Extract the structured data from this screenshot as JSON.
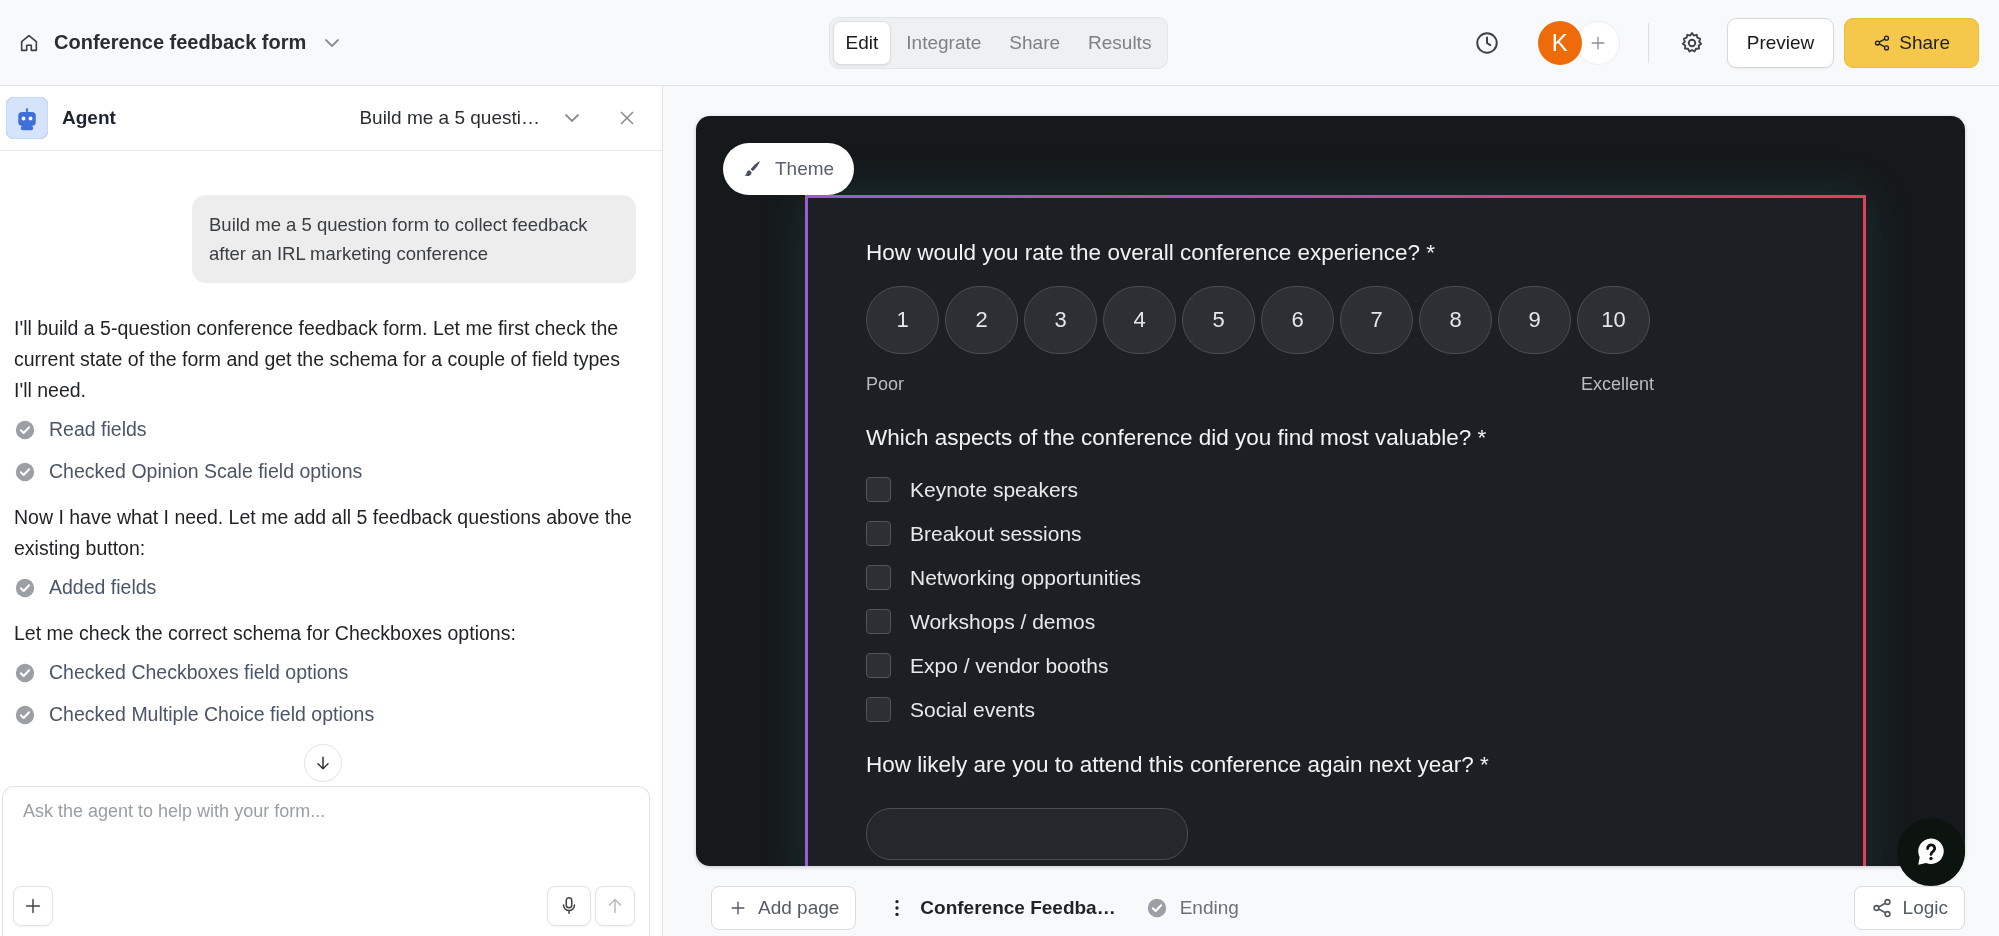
{
  "topbar": {
    "title": "Conference feedback form",
    "tabs": [
      {
        "label": "Edit",
        "selected": true
      },
      {
        "label": "Integrate",
        "selected": false
      },
      {
        "label": "Share",
        "selected": false
      },
      {
        "label": "Results",
        "selected": false
      }
    ],
    "avatar": "K",
    "preview": "Preview",
    "share": "Share"
  },
  "agent": {
    "title": "Agent",
    "thread": "Build me a 5 questi…",
    "messages": [
      {
        "kind": "user",
        "text": "Build me a 5 question form to collect feedback after an IRL marketing conference"
      },
      {
        "kind": "text",
        "text": "I'll build a 5-question conference feedback form. Let me first check the current state of the form and get the schema for a couple of field types I'll need."
      },
      {
        "kind": "tool",
        "text": "Read fields"
      },
      {
        "kind": "tool",
        "text": "Checked Opinion Scale field options"
      },
      {
        "kind": "text",
        "text": "Now I have what I need. Let me add all 5 feedback questions above the existing button:"
      },
      {
        "kind": "tool",
        "text": "Added fields"
      },
      {
        "kind": "text",
        "text": "Let me check the correct schema for Checkboxes options:"
      },
      {
        "kind": "tool",
        "text": "Checked Checkboxes field options"
      },
      {
        "kind": "tool",
        "text": "Checked Multiple Choice field options"
      }
    ],
    "input": {
      "placeholder": "Ask the agent to help with your form..."
    }
  },
  "canvas": {
    "theme": "Theme",
    "questions": [
      {
        "kind": "scale",
        "title": "How would you rate the overall conference experience? *",
        "options": [
          {
            "label": "1",
            "selected": false
          },
          {
            "label": "2",
            "selected": false
          },
          {
            "label": "3",
            "selected": false
          },
          {
            "label": "4",
            "selected": false
          },
          {
            "label": "5",
            "selected": false
          },
          {
            "label": "6",
            "selected": false
          },
          {
            "label": "7",
            "selected": false
          },
          {
            "label": "8",
            "selected": false
          },
          {
            "label": "9",
            "selected": false
          },
          {
            "label": "10",
            "selected": false
          }
        ],
        "low": "Poor",
        "high": "Excellent"
      },
      {
        "kind": "checkboxes",
        "title": "Which aspects of the conference did you find most valuable? *",
        "options": [
          {
            "label": "Keynote speakers",
            "checked": false
          },
          {
            "label": "Breakout sessions",
            "checked": false
          },
          {
            "label": "Networking opportunities",
            "checked": false
          },
          {
            "label": "Workshops / demos",
            "checked": false
          },
          {
            "label": "Expo / vendor booths",
            "checked": false
          },
          {
            "label": "Social events",
            "checked": false
          }
        ]
      },
      {
        "kind": "choice",
        "title": "How likely are you to attend this conference again next year? *"
      }
    ]
  },
  "pages": {
    "add": "Add page",
    "items": [
      {
        "kind": "page",
        "label": "Conference Feedba…"
      },
      {
        "kind": "ending",
        "label": "Ending"
      }
    ],
    "logic": "Logic"
  }
}
